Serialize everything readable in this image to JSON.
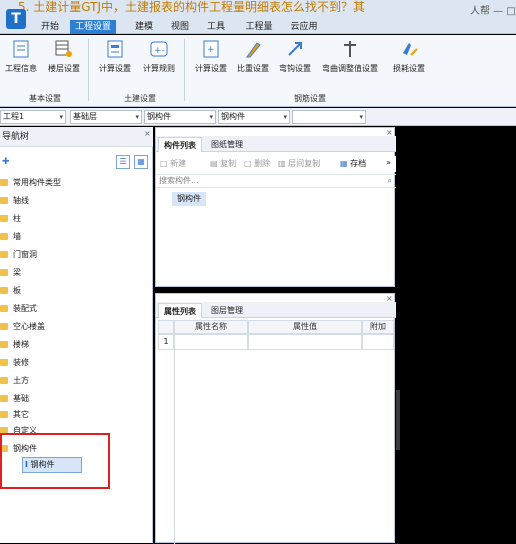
{
  "title": {
    "text": "5. 土建计量GTJ中，土建报表的构件工程量明细表怎么找不到？其",
    "right_text": "人帮  — □"
  },
  "app_logo": "T",
  "tabs": [
    "开始",
    "工程设置",
    "建模",
    "视图",
    "工具",
    "工程量",
    "云应用"
  ],
  "active_tab": "工程设置",
  "ribbon": {
    "buttons": [
      {
        "label": "工程信息",
        "icon": "project-info-icon"
      },
      {
        "label": "楼层设置",
        "icon": "floor-setting-icon"
      },
      {
        "label": "计算设置",
        "icon": "calc-setting-icon"
      },
      {
        "label": "计算规则",
        "icon": "calc-rule-icon"
      },
      {
        "label": "计算设置",
        "icon": "rebar-calc-icon"
      },
      {
        "label": "比重设置",
        "icon": "density-icon"
      },
      {
        "label": "弯钩设置",
        "icon": "hook-icon"
      },
      {
        "label": "弯曲调整值设置",
        "icon": "bend-adjust-icon"
      },
      {
        "label": "损耗设置",
        "icon": "loss-icon"
      }
    ],
    "groups": [
      "基本设置",
      "土建设置",
      "钢筋设置"
    ]
  },
  "dropdowns": [
    "工程1",
    "基础层",
    "钢构件",
    "钢构件",
    ""
  ],
  "nav": {
    "header": "导航树",
    "items": [
      "常用构件类型",
      "轴线",
      "柱",
      "墙",
      "门窗洞",
      "梁",
      "板",
      "装配式",
      "空心楼盖",
      "楼梯",
      "装修",
      "土方",
      "基础",
      "其它",
      "自定义",
      "钢构件"
    ],
    "selected": "钢构件"
  },
  "component_panel": {
    "tabs": [
      "构件列表",
      "图纸管理"
    ],
    "toolbar": [
      "新建",
      "复制",
      "删除",
      "层间复制",
      "存档"
    ],
    "search_placeholder": "搜索构件...",
    "items": [
      "钢构件"
    ]
  },
  "property_panel": {
    "tabs": [
      "属性列表",
      "图层管理"
    ],
    "columns": [
      "属性名称",
      "属性值",
      "附加"
    ],
    "rows": [
      [
        "1",
        "",
        "",
        ""
      ]
    ]
  }
}
